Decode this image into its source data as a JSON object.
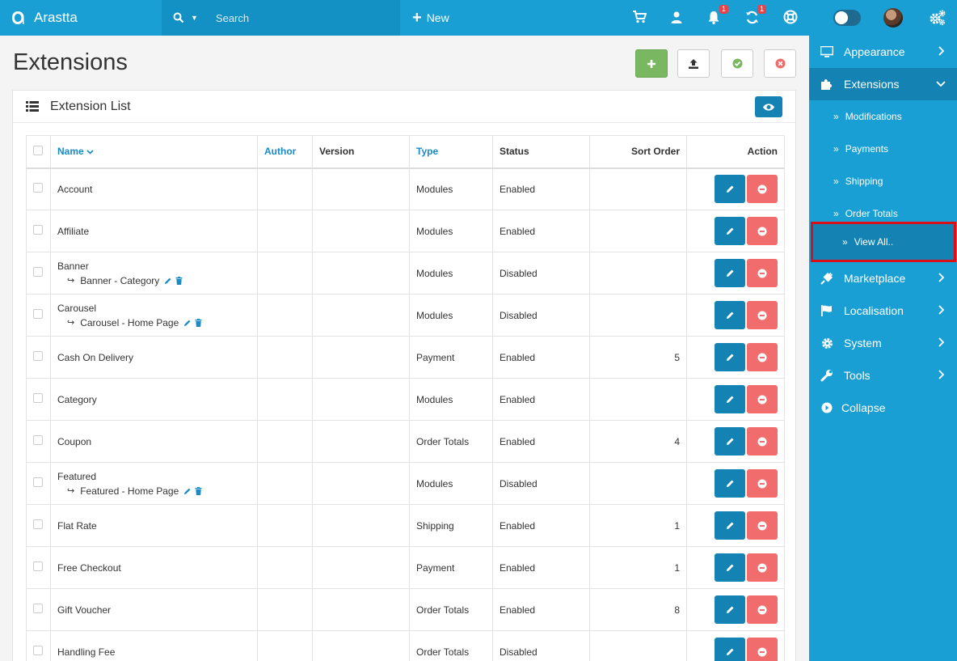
{
  "app": {
    "name": "Arastta"
  },
  "topbar": {
    "search_placeholder": "Search",
    "new_label": "New",
    "notifications_badge": "1",
    "updates_badge": "1"
  },
  "page": {
    "title": "Extensions"
  },
  "panel": {
    "title": "Extension List"
  },
  "table": {
    "headers": {
      "name": "Name",
      "author": "Author",
      "version": "Version",
      "type": "Type",
      "status": "Status",
      "sort_order": "Sort Order",
      "action": "Action"
    },
    "rows": [
      {
        "name": "Account",
        "sub": "",
        "author": "",
        "version": "",
        "type": "Modules",
        "status": "Enabled",
        "sort": ""
      },
      {
        "name": "Affiliate",
        "sub": "",
        "author": "",
        "version": "",
        "type": "Modules",
        "status": "Enabled",
        "sort": ""
      },
      {
        "name": "Banner",
        "sub": "Banner - Category",
        "author": "",
        "version": "",
        "type": "Modules",
        "status": "Disabled",
        "sort": ""
      },
      {
        "name": "Carousel",
        "sub": "Carousel - Home Page",
        "author": "",
        "version": "",
        "type": "Modules",
        "status": "Disabled",
        "sort": ""
      },
      {
        "name": "Cash On Delivery",
        "sub": "",
        "author": "",
        "version": "",
        "type": "Payment",
        "status": "Enabled",
        "sort": "5"
      },
      {
        "name": "Category",
        "sub": "",
        "author": "",
        "version": "",
        "type": "Modules",
        "status": "Enabled",
        "sort": ""
      },
      {
        "name": "Coupon",
        "sub": "",
        "author": "",
        "version": "",
        "type": "Order Totals",
        "status": "Enabled",
        "sort": "4"
      },
      {
        "name": "Featured",
        "sub": "Featured - Home Page",
        "author": "",
        "version": "",
        "type": "Modules",
        "status": "Disabled",
        "sort": ""
      },
      {
        "name": "Flat Rate",
        "sub": "",
        "author": "",
        "version": "",
        "type": "Shipping",
        "status": "Enabled",
        "sort": "1"
      },
      {
        "name": "Free Checkout",
        "sub": "",
        "author": "",
        "version": "",
        "type": "Payment",
        "status": "Enabled",
        "sort": "1"
      },
      {
        "name": "Gift Voucher",
        "sub": "",
        "author": "",
        "version": "",
        "type": "Order Totals",
        "status": "Enabled",
        "sort": "8"
      },
      {
        "name": "Handling Fee",
        "sub": "",
        "author": "",
        "version": "",
        "type": "Order Totals",
        "status": "Disabled",
        "sort": ""
      }
    ]
  },
  "sidebar": {
    "items": [
      {
        "label": "Appearance",
        "icon": "monitor-icon"
      },
      {
        "label": "Extensions",
        "icon": "puzzle-icon"
      },
      {
        "label": "Modifications"
      },
      {
        "label": "Payments"
      },
      {
        "label": "Shipping"
      },
      {
        "label": "Order Totals"
      },
      {
        "label": "View All.."
      },
      {
        "label": "Marketplace",
        "icon": "plug-icon"
      },
      {
        "label": "Localisation",
        "icon": "flag-icon"
      },
      {
        "label": "System",
        "icon": "gear-icon"
      },
      {
        "label": "Tools",
        "icon": "wrench-icon"
      },
      {
        "label": "Collapse",
        "icon": "collapse-icon"
      }
    ]
  },
  "colors": {
    "primary": "#1a9fd4",
    "primary_dark": "#1483b3",
    "success": "#79b861",
    "danger": "#f16c6c",
    "highlight_border": "#d9101a"
  }
}
